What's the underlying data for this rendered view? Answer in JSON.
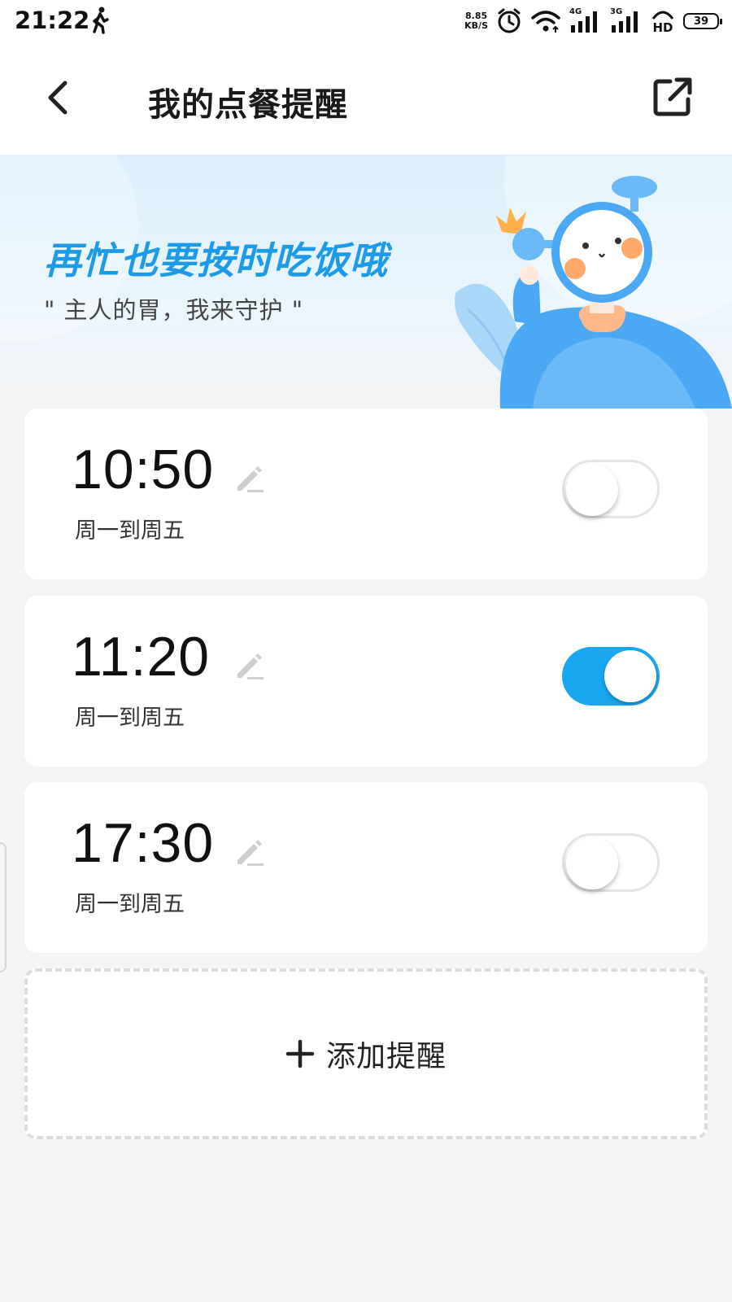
{
  "status_bar": {
    "time": "21:22",
    "speed_value": "8.85",
    "speed_unit": "KB/S",
    "network1": "4G",
    "network2": "3G",
    "hd": "HD",
    "battery": "39"
  },
  "header": {
    "title": "我的点餐提醒"
  },
  "banner": {
    "title": "再忙也要按时吃饭哦",
    "subtitle": "\" 主人的胃，我来守护 \""
  },
  "reminders": [
    {
      "time": "10:50",
      "repeat": "周一到周五",
      "enabled": false
    },
    {
      "time": "11:20",
      "repeat": "周一到周五",
      "enabled": true
    },
    {
      "time": "17:30",
      "repeat": "周一到周五",
      "enabled": false
    }
  ],
  "add_button": {
    "label": "添加提醒"
  },
  "colors": {
    "accent": "#1aa7f2",
    "banner_title": "#1e9be8"
  },
  "icons": [
    "back-icon",
    "share-icon",
    "edit-icon",
    "plus-icon",
    "walk-icon",
    "alarm-icon",
    "wifi-icon",
    "signal-icon",
    "battery-icon"
  ]
}
